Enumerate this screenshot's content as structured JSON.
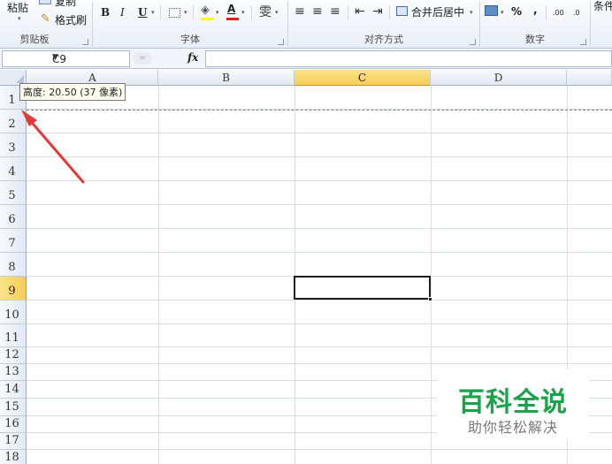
{
  "ribbon": {
    "clipboard": {
      "paste_label": "粘贴",
      "cut_label": "复制",
      "format_painter_label": "格式刷",
      "group_label": "剪贴板"
    },
    "font": {
      "bold": "B",
      "italic": "I",
      "underline": "U",
      "group_label": "字体",
      "font_color_letter": "A"
    },
    "alignment": {
      "merge_label": "合并后居中",
      "group_label": "对齐方式"
    },
    "number": {
      "percent": "%",
      "comma": ",",
      "inc_decimal": ".00",
      "dec_decimal": ".0",
      "group_label": "数字"
    },
    "styles": {
      "conditional_label": "条件"
    }
  },
  "formula_bar": {
    "name_box": "C9",
    "fx_label": "fx",
    "formula_value": ""
  },
  "grid": {
    "columns": [
      "A",
      "B",
      "C",
      "D"
    ],
    "active_column": "C",
    "rows": [
      "1",
      "2",
      "3",
      "4",
      "5",
      "6",
      "7",
      "8",
      "9",
      "10",
      "11",
      "12",
      "13",
      "14",
      "15",
      "16",
      "17",
      "18"
    ],
    "active_row": "9",
    "selected_cell": "C9"
  },
  "tooltip": {
    "text": "高度: 20.50 (37 像素)"
  },
  "watermark": {
    "title": "百科全说",
    "subtitle": "助你轻松解决"
  },
  "colors": {
    "accent_header": "#f7cd56",
    "arrow": "#e53935",
    "watermark_green": "#1aa34a"
  }
}
